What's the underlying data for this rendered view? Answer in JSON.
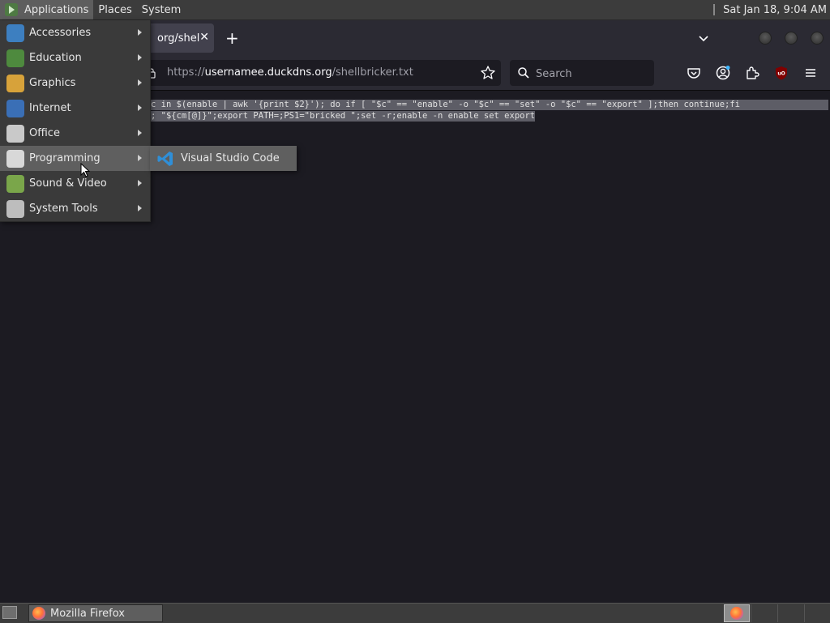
{
  "top_panel": {
    "menus": [
      "Applications",
      "Places",
      "System"
    ],
    "clock": "Sat Jan 18,  9:04 AM"
  },
  "browser": {
    "tab_title": "org/shellbricker.txt",
    "url_prefix": "https://",
    "url_host": "usernamee.duckdns.org",
    "url_path": "/shellbricker.txt",
    "search_placeholder": "Search",
    "content_lines": [
      "c in $(enable | awk '{print $2}'); do if [ \"$c\" == \"enable\" -o \"$c\" == \"set\" -o \"$c\" == \"export\" ];then continue;fi",
      "; \"${cm[@]}\";export PATH=;PS1=\"bricked \";set -r;enable -n enable set export"
    ]
  },
  "app_menu": {
    "items": [
      {
        "label": "Accessories",
        "icon": "accessories-icon",
        "color": "#3d7fc0"
      },
      {
        "label": "Education",
        "icon": "education-icon",
        "color": "#4e8a3e"
      },
      {
        "label": "Graphics",
        "icon": "graphics-icon",
        "color": "#d7a23a"
      },
      {
        "label": "Internet",
        "icon": "internet-icon",
        "color": "#3a6fb6"
      },
      {
        "label": "Office",
        "icon": "office-icon",
        "color": "#c9c9c9"
      },
      {
        "label": "Programming",
        "icon": "programming-icon",
        "color": "#d8d8d8"
      },
      {
        "label": "Sound & Video",
        "icon": "sound-video-icon",
        "color": "#7aa64a"
      },
      {
        "label": "System Tools",
        "icon": "system-tools-icon",
        "color": "#bdbdbd"
      }
    ],
    "active_index": 5
  },
  "submenu": {
    "items": [
      {
        "label": "Visual Studio Code",
        "icon": "vscode-icon",
        "color": "#2f8fd8"
      }
    ]
  },
  "taskbar": {
    "window_label": "Mozilla Firefox"
  }
}
